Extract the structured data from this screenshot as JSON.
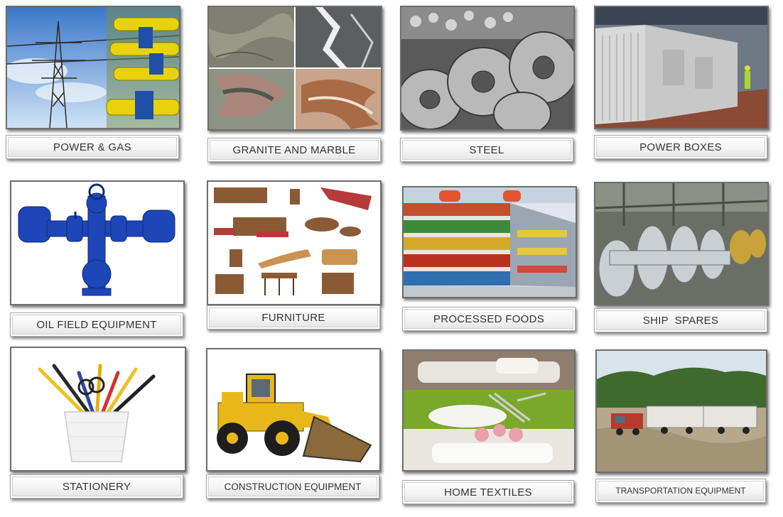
{
  "categories": [
    {
      "id": "power-gas",
      "label": "POWER & GAS"
    },
    {
      "id": "granite-marble",
      "label": "GRANITE AND MARBLE"
    },
    {
      "id": "steel",
      "label": "STEEL"
    },
    {
      "id": "power-boxes",
      "label": "POWER BOXES"
    },
    {
      "id": "oil-field",
      "label": "OIL FIELD EQUIPMENT"
    },
    {
      "id": "furniture",
      "label": "FURNITURE"
    },
    {
      "id": "processed-foods",
      "label": "PROCESSED FOODS"
    },
    {
      "id": "ship-spares",
      "label": "SHIP  SPARES"
    },
    {
      "id": "stationery",
      "label": "STATIONERY"
    },
    {
      "id": "construction",
      "label": "CONSTRUCTION EQUIPMENT"
    },
    {
      "id": "home-textiles",
      "label": "HOME TEXTILES"
    },
    {
      "id": "transportation",
      "label": "TRANSPORTATION EQUIPMENT"
    }
  ]
}
